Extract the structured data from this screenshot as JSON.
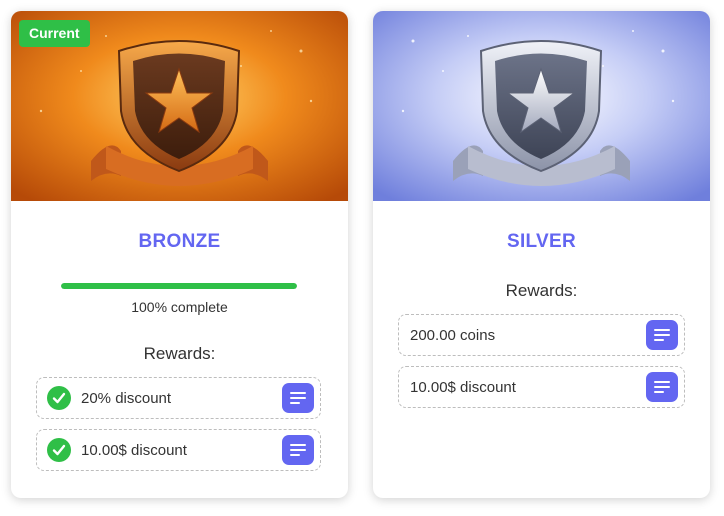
{
  "tiers": [
    {
      "name": "BRONZE",
      "current_badge": "Current",
      "progress_fraction": 1.0,
      "progress_text": "100% complete",
      "rewards_label": "Rewards:",
      "rewards": [
        {
          "text": "20% discount",
          "achieved": true
        },
        {
          "text": "10.00$ discount",
          "achieved": true
        }
      ]
    },
    {
      "name": "SILVER",
      "rewards_label": "Rewards:",
      "rewards": [
        {
          "text": "200.00 coins",
          "achieved": false
        },
        {
          "text": "10.00$ discount",
          "achieved": false
        }
      ]
    }
  ],
  "colors": {
    "accent": "#6366f1",
    "success": "#2fbf47",
    "bronze_bg": "#e8741a",
    "silver_bg": "#7f8fe6"
  },
  "icons": {
    "badge": "shield-star-icon",
    "check": "check-circle-icon",
    "details": "details-lines-icon"
  }
}
